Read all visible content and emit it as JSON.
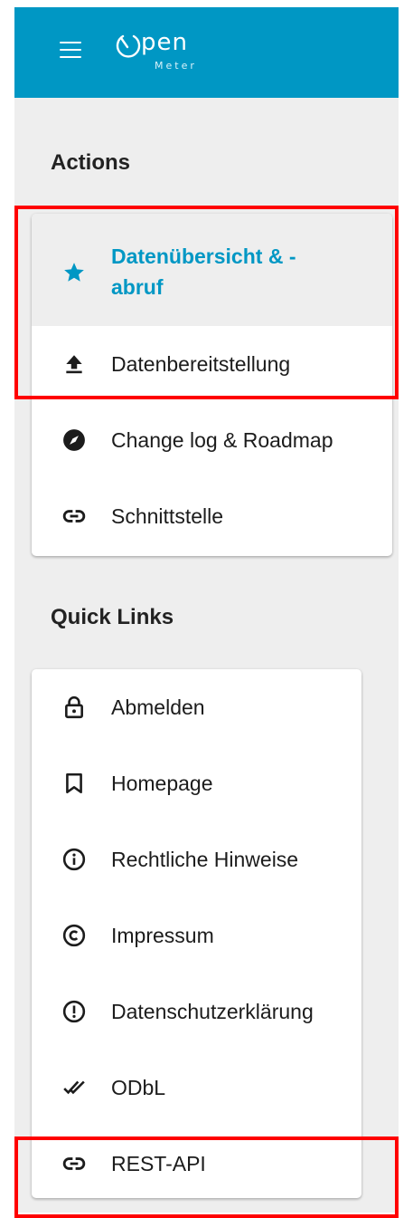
{
  "header": {
    "menu_icon": "hamburger-menu-icon",
    "logo_word": "pen",
    "logo_sub": "Meter",
    "background_color": "#0097c4"
  },
  "actions": {
    "title": "Actions",
    "items": [
      {
        "label": "Datenübersicht & -abruf",
        "icon": "star-icon",
        "active": true
      },
      {
        "label": "Datenbereitstellung",
        "icon": "upload-icon",
        "active": false
      },
      {
        "label": "Change log & Roadmap",
        "icon": "compass-icon",
        "active": false
      },
      {
        "label": "Schnittstelle",
        "icon": "link-icon",
        "active": false
      }
    ]
  },
  "quick_links": {
    "title": "Quick Links",
    "items": [
      {
        "label": "Abmelden",
        "icon": "lock-icon"
      },
      {
        "label": "Homepage",
        "icon": "bookmark-icon"
      },
      {
        "label": "Rechtliche Hinweise",
        "icon": "info-icon"
      },
      {
        "label": "Impressum",
        "icon": "copyright-icon"
      },
      {
        "label": "Datenschutzerklärung",
        "icon": "exclamation-icon"
      },
      {
        "label": "ODbL",
        "icon": "double-check-icon"
      },
      {
        "label": "REST-API",
        "icon": "link-icon"
      }
    ]
  },
  "colors": {
    "accent": "#0097c4",
    "highlight_border": "#ff0000",
    "sidebar_background": "#eeeeee"
  }
}
